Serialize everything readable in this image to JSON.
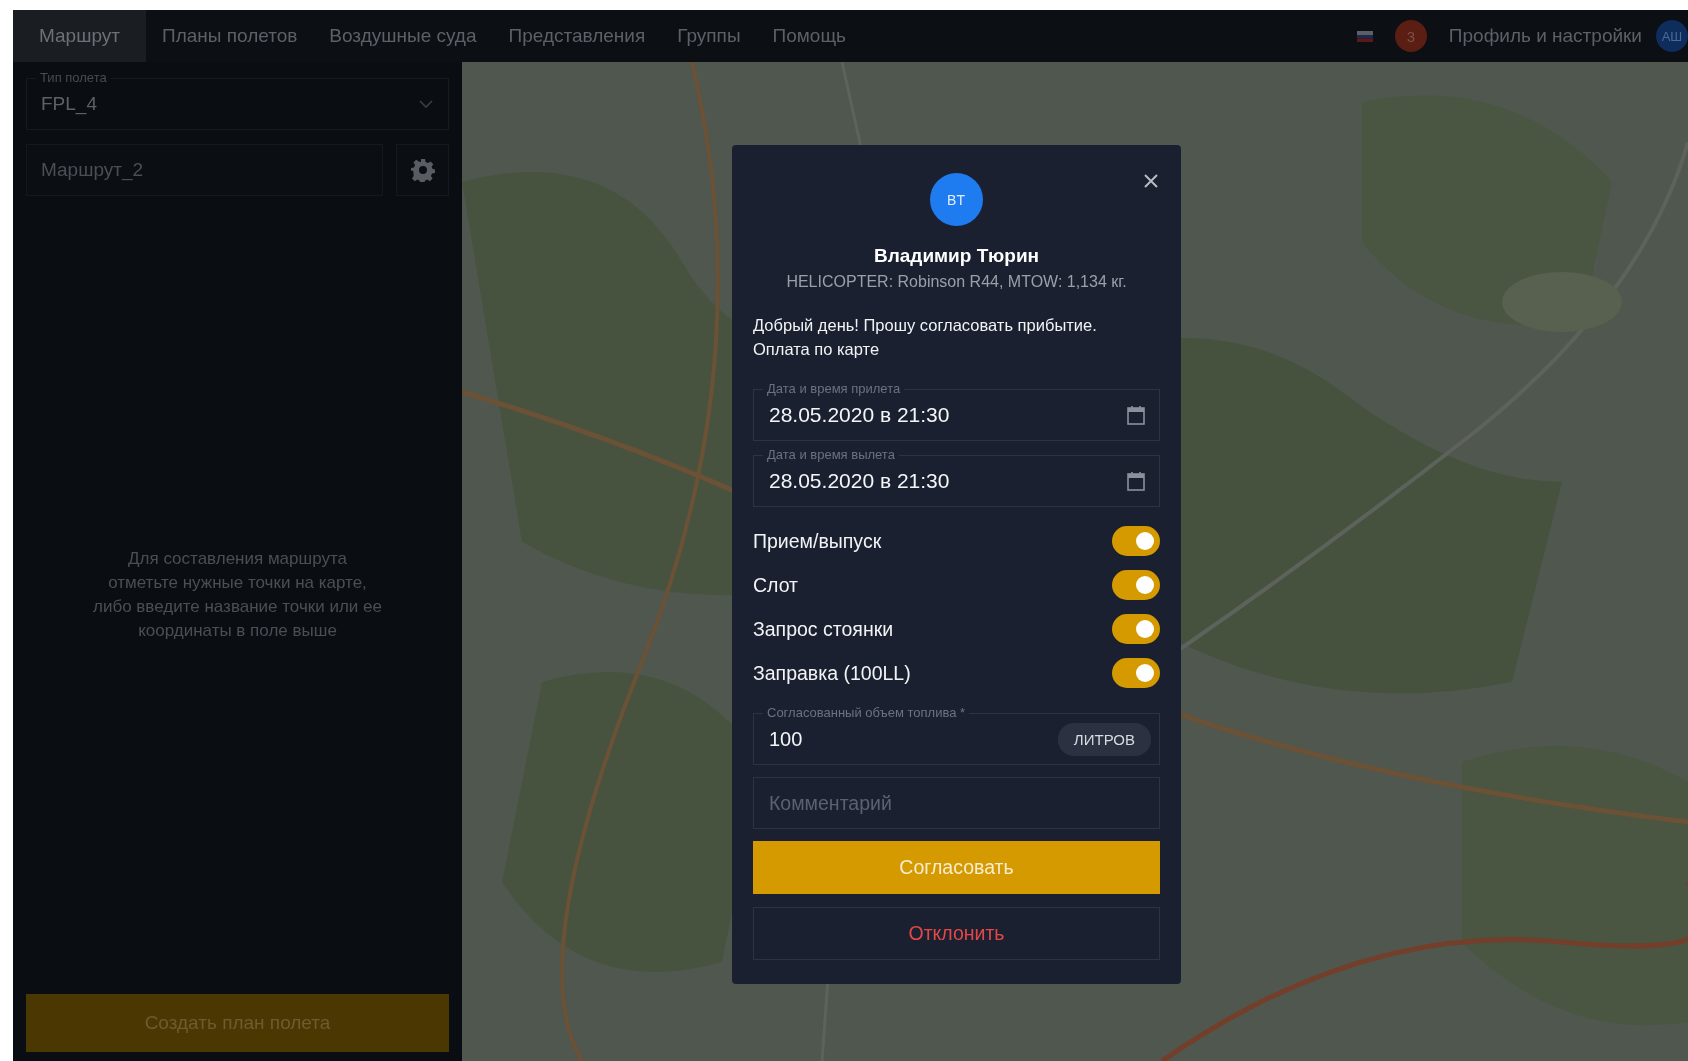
{
  "nav": {
    "items": [
      {
        "label": "Маршрут",
        "selected": true
      },
      {
        "label": "Планы полетов",
        "selected": false
      },
      {
        "label": "Воздушные суда",
        "selected": false
      },
      {
        "label": "Представления",
        "selected": false
      },
      {
        "label": "Группы",
        "selected": false
      },
      {
        "label": "Помощь",
        "selected": false
      }
    ],
    "notification_count": "3",
    "profile_label": "Профиль и настройки",
    "avatar_initials": "АШ"
  },
  "sidebar": {
    "flight_type": {
      "label": "Тип полета",
      "value": "FPL_4"
    },
    "route": {
      "placeholder": "Маршрут_2"
    },
    "hint": "Для составления маршрута отметьте нужные точки на карте, либо введите название точки или ее координаты в поле выше",
    "create_button": "Создать план полета"
  },
  "dialog": {
    "avatar_initials": "ВТ",
    "name": "Владимир Тюрин",
    "aircraft": "HELICOPTER: Robinson R44, MTOW: 1,134 кг.",
    "message": "Добрый день! Прошу согласовать прибытие. Оплата по карте",
    "date_fields": [
      {
        "label": "Дата и время прилета",
        "value": "28.05.2020 в 21:30"
      },
      {
        "label": "Дата и время вылета",
        "value": "28.05.2020 в 21:30"
      }
    ],
    "services": [
      {
        "label": "Прием/выпуск",
        "on": true
      },
      {
        "label": "Слот",
        "on": true
      },
      {
        "label": "Запрос стоянки",
        "on": true
      },
      {
        "label": "Заправка (100LL)",
        "on": true
      }
    ],
    "fuel": {
      "label": "Согласованный объем топлива *",
      "value": "100",
      "unit": "ЛИТРОВ"
    },
    "comment": {
      "placeholder": "Комментарий"
    },
    "approve_button": "Согласовать",
    "reject_button": "Отклонить"
  }
}
